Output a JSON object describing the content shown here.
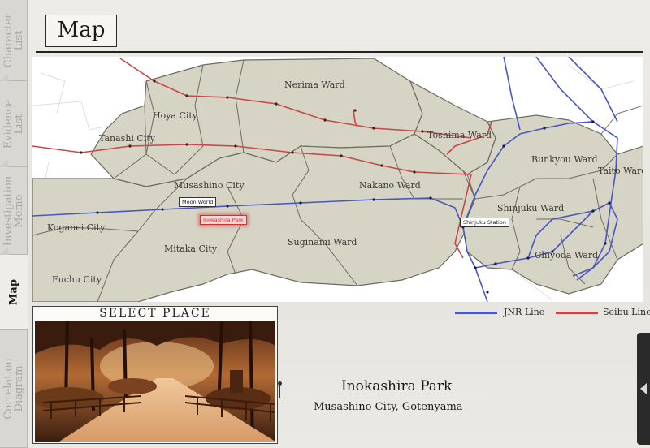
{
  "header": {
    "title": "Map"
  },
  "tabs": [
    {
      "label": "Character\nList",
      "active": false
    },
    {
      "label": "Evidence\nList",
      "active": false
    },
    {
      "label": "Investigation\nMemo",
      "active": false
    },
    {
      "label": "Map",
      "active": true
    },
    {
      "label": "Correlation\nDiagram",
      "active": false
    }
  ],
  "map": {
    "wards": {
      "nerima": "Nerima Ward",
      "hoya": "Hoya City",
      "tanashi": "Tanashi City",
      "toshima": "Toshima Ward",
      "bunkyou": "Bunkyou Ward",
      "taito": "Taito Ward",
      "musashino": "Musashino City",
      "nakano": "Nakano Ward",
      "shinjuku": "Shinjuku Ward",
      "koganei": "Koganei City",
      "mitaka": "Mitaka City",
      "suginami": "Suginami Ward",
      "chiyoda": "Chiyoda Ward",
      "fuchu": "Fuchu City"
    },
    "stations": {
      "moon_world": "Moon World",
      "inokashira": "Inokashira Park",
      "shinjuku": "Shinjuku Station"
    },
    "selected_station": "Inokashira Park",
    "colors": {
      "jnr": "#4a55c0",
      "seibu": "#c84848",
      "land": "#d6d4c4",
      "border": "#6e6c62"
    }
  },
  "legend": {
    "jnr": "JNR Line",
    "seibu": "Seibu Line"
  },
  "select_place": {
    "title": "SELECT PLACE",
    "place_name": "Inokashira Park",
    "place_address": "Musashino City, Gotenyama"
  }
}
